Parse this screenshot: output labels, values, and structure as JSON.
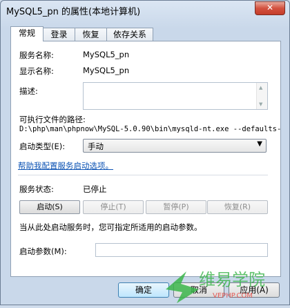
{
  "window": {
    "title": "MySQL5_pn 的属性(本地计算机)",
    "close_label": "✕"
  },
  "tabs": [
    "常规",
    "登录",
    "恢复",
    "依存关系"
  ],
  "general": {
    "service_name_label": "服务名称:",
    "service_name": "MySQL5_pn",
    "display_name_label": "显示名称:",
    "display_name": "MySQL5_pn",
    "description_label": "描述:",
    "exe_path_label": "可执行文件的路径:",
    "exe_path": "D:\\php\\man\\phpnow\\MySQL-5.0.90\\bin\\mysqld-nt.exe --defaults-",
    "startup_type_label": "启动类型(E):",
    "startup_type_value": "手动",
    "help_link": "帮助我配置服务启动选项。",
    "status_label": "服务状态:",
    "status_value": "已停止",
    "buttons": {
      "start": "启动(S)",
      "stop": "停止(T)",
      "pause": "暂停(P)",
      "resume": "恢复(R)"
    },
    "hint": "当从此处启动服务时，您可指定所适用的启动参数。",
    "params_label": "启动参数(M):"
  },
  "dialog": {
    "ok": "确定",
    "cancel": "取消",
    "apply": "应用(A)"
  },
  "watermark": {
    "text": "维易学院",
    "url": "VEPHP.COM"
  },
  "colors": {
    "link": "#0c53b4",
    "close": "#c43c2a",
    "watermark_green": "#3bb54a"
  }
}
